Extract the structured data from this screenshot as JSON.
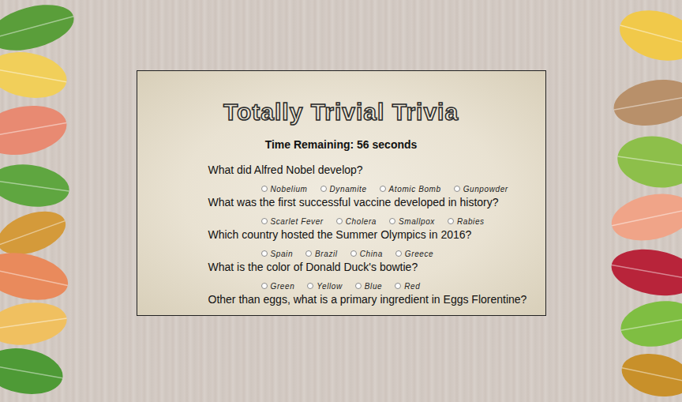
{
  "title": "Totally Trivial Trivia",
  "timer": "Time Remaining: 56 seconds",
  "questions": [
    {
      "text": "What did Alfred Nobel develop?",
      "options": [
        {
          "label": "Nobelium",
          "selected": false
        },
        {
          "label": "Dynamite",
          "selected": false
        },
        {
          "label": "Atomic Bomb",
          "selected": false
        },
        {
          "label": "Gunpowder",
          "selected": false
        }
      ]
    },
    {
      "text": "What was the first successful vaccine developed in history?",
      "options": [
        {
          "label": "Scarlet Fever",
          "selected": false
        },
        {
          "label": "Cholera",
          "selected": false
        },
        {
          "label": "Smallpox",
          "selected": false
        },
        {
          "label": "Rabies",
          "selected": false
        }
      ]
    },
    {
      "text": "Which country hosted the Summer Olympics in 2016?",
      "options": [
        {
          "label": "Spain",
          "selected": false
        },
        {
          "label": "Brazil",
          "selected": false
        },
        {
          "label": "China",
          "selected": false
        },
        {
          "label": "Greece",
          "selected": false
        }
      ]
    },
    {
      "text": "What is the color of Donald Duck's bowtie?",
      "options": [
        {
          "label": "Green",
          "selected": false
        },
        {
          "label": "Yellow",
          "selected": false
        },
        {
          "label": "Blue",
          "selected": false
        },
        {
          "label": "Red",
          "selected": false
        }
      ]
    },
    {
      "text": "Other than eggs, what is a primary ingredient in Eggs Florentine?",
      "options": []
    }
  ]
}
